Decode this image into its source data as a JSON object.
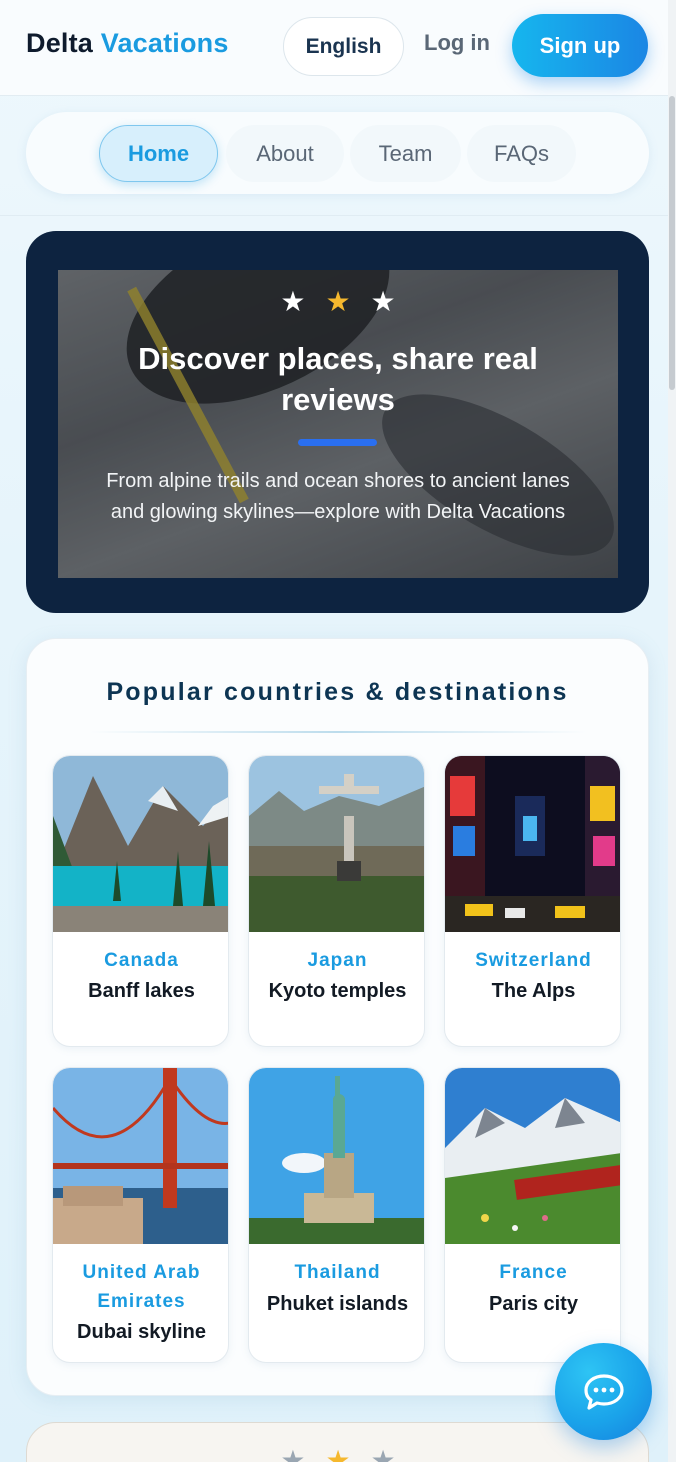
{
  "header": {
    "brand_first": "Delta",
    "brand_second": "Vacations",
    "language_label": "English",
    "login_label": "Log in",
    "signup_label": "Sign up"
  },
  "nav": {
    "items": [
      {
        "label": "Home",
        "active": true
      },
      {
        "label": "About",
        "active": false
      },
      {
        "label": "Team",
        "active": false
      },
      {
        "label": "FAQs",
        "active": false
      }
    ]
  },
  "hero": {
    "title": "Discover places, share real reviews",
    "subtitle": "From alpine trails and ocean shores to ancient lanes and glowing skylines—explore with Delta Vacations",
    "rating": {
      "star_icons": [
        "star-icon",
        "star-icon",
        "star-icon"
      ],
      "highlight_index": 1
    }
  },
  "destinations": {
    "heading": "Popular countries & destinations",
    "items": [
      {
        "country": "Canada",
        "place": "Banff lakes",
        "image": "mountain-lake-photo"
      },
      {
        "country": "Japan",
        "place": "Kyoto temples",
        "image": "christ-statue-photo"
      },
      {
        "country": "Switzerland",
        "place": "The Alps",
        "image": "times-square-photo"
      },
      {
        "country": "United Arab Emirates",
        "place": "Dubai skyline",
        "image": "golden-gate-photo"
      },
      {
        "country": "Thailand",
        "place": "Phuket islands",
        "image": "statue-of-liberty-photo"
      },
      {
        "country": "France",
        "place": "Paris city",
        "image": "alpine-train-photo"
      }
    ]
  },
  "chat": {
    "icon": "chat-bubble-icon"
  },
  "colors": {
    "accent": "#1a9be0",
    "hero_bg": "#0d2340",
    "star_gold": "#f5b82e",
    "heading": "#0d3553"
  }
}
